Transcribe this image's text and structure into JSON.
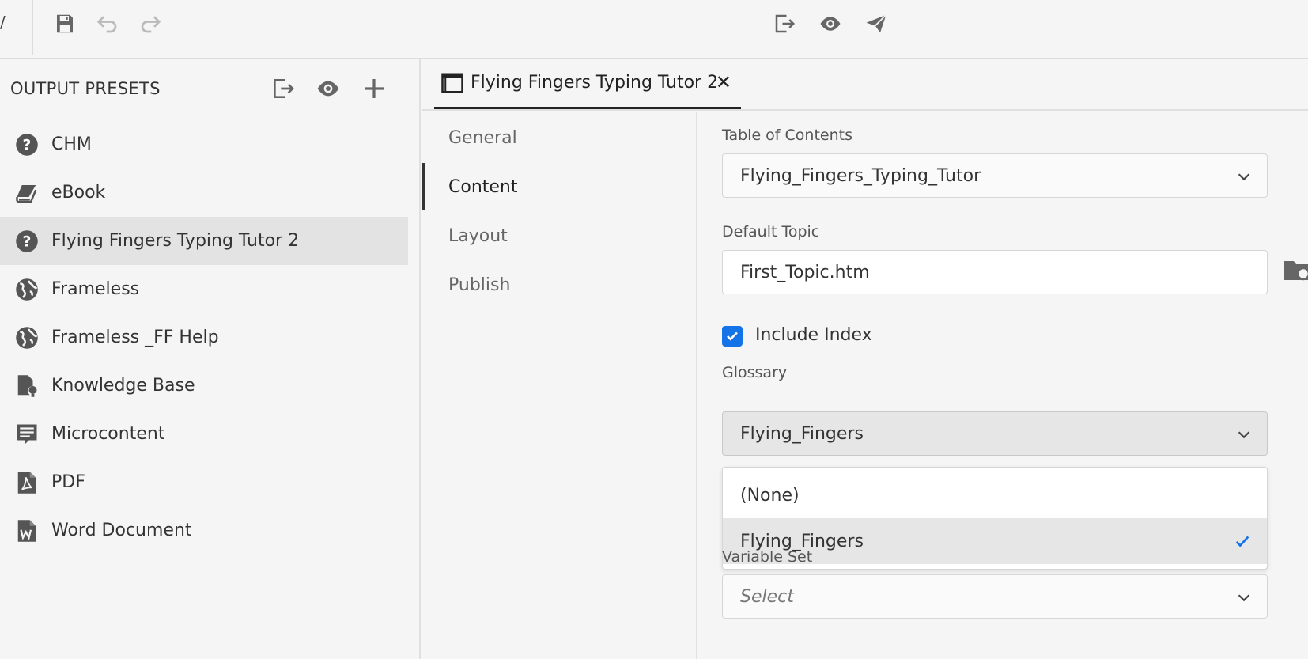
{
  "toolbar": {
    "fragment_text": "/",
    "icons": {
      "save": "save-icon",
      "undo": "undo-icon",
      "redo": "redo-icon",
      "generate": "generate-output-icon",
      "view": "view-output-icon",
      "publish": "publish-icon"
    }
  },
  "presets_panel": {
    "title": "OUTPUT PRESETS",
    "items": [
      {
        "label": "CHM",
        "icon": "help-circle-icon"
      },
      {
        "label": "eBook",
        "icon": "ebook-icon"
      },
      {
        "label": "Flying Fingers Typing Tutor 2",
        "icon": "help-circle-icon"
      },
      {
        "label": "Frameless",
        "icon": "globe-icon"
      },
      {
        "label": "Frameless _FF Help",
        "icon": "globe-icon"
      },
      {
        "label": "Knowledge Base",
        "icon": "knowledge-base-icon"
      },
      {
        "label": "Microcontent",
        "icon": "microcontent-icon"
      },
      {
        "label": "PDF",
        "icon": "pdf-icon"
      },
      {
        "label": "Word Document",
        "icon": "word-document-icon"
      }
    ],
    "selected_index": 2
  },
  "tab": {
    "label": "Flying Fingers Typing Tutor 2",
    "close": "✕"
  },
  "settings_nav": {
    "items": [
      "General",
      "Content",
      "Layout",
      "Publish"
    ],
    "active": "Content"
  },
  "content": {
    "toc": {
      "label": "Table of Contents",
      "value": "Flying_Fingers_Typing_Tutor"
    },
    "default_topic": {
      "label": "Default Topic",
      "value": "First_Topic.htm"
    },
    "include_index": {
      "label": "Include Index",
      "checked": true
    },
    "glossary": {
      "label": "Glossary",
      "value": "Flying_Fingers",
      "options": [
        "(None)",
        "Flying_Fingers"
      ],
      "selected": "Flying_Fingers"
    },
    "variable_set": {
      "label": "Variable Set",
      "placeholder": "Select"
    }
  },
  "colors": {
    "accent": "#1473e6",
    "selected_bg": "#e3e3e3"
  }
}
